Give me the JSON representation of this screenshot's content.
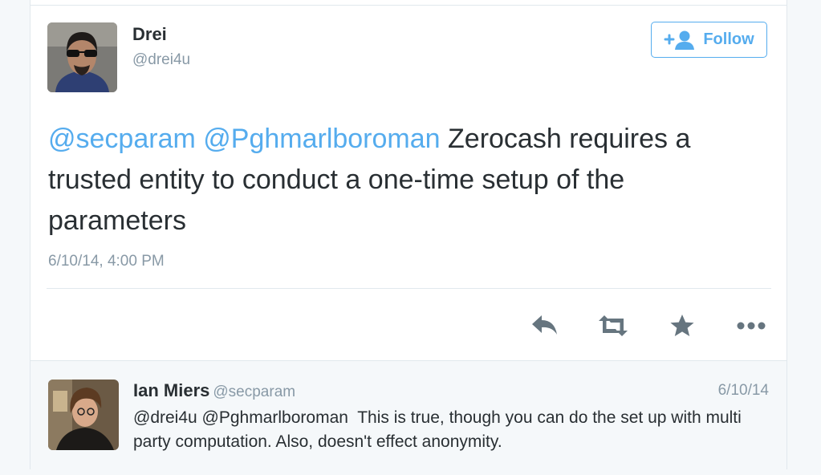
{
  "tweet": {
    "author_name": "Drei",
    "author_handle": "@drei4u",
    "follow_label": "Follow",
    "mention_1": "@secparam",
    "mention_2": "@Pghmarlboroman",
    "text": "Zerocash requires a trusted entity to conduct a one-time setup of the parameters",
    "timestamp": "6/10/14, 4:00 PM"
  },
  "actions": {
    "reply_icon": "reply-icon",
    "retweet_icon": "retweet-icon",
    "favorite_icon": "star-icon",
    "more_icon": "more-icon"
  },
  "reply": {
    "author_name": "Ian Miers",
    "author_handle": "@secparam",
    "date": "6/10/14",
    "text": "@drei4u @Pghmarlboroman  This is true, though you can do the set up with multi party computation. Also, doesn't effect anonymity."
  },
  "colors": {
    "accent": "#55acee",
    "text": "#292f33",
    "muted": "#8899a6",
    "border": "#e1e8ed",
    "icon": "#66757f"
  }
}
